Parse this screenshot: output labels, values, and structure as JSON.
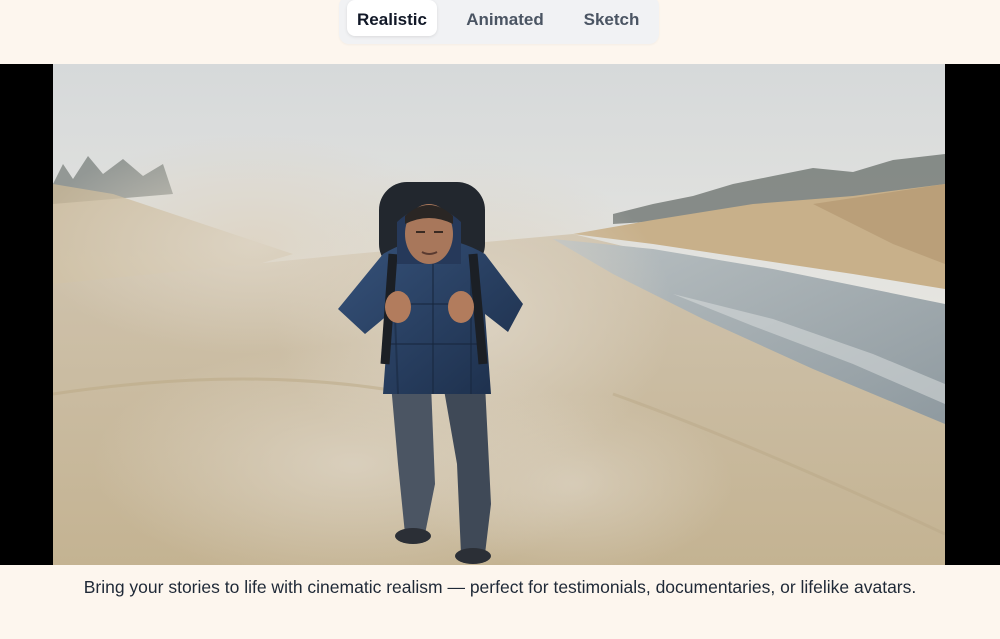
{
  "tabs": {
    "items": [
      {
        "label": "Realistic",
        "active": true
      },
      {
        "label": "Animated",
        "active": false
      },
      {
        "label": "Sketch",
        "active": false
      }
    ]
  },
  "video": {
    "scene": "hiker-in-sandstorm"
  },
  "caption": {
    "text": "Bring your stories to life with cinematic realism — perfect for testimonials, documentaries, or lifelike avatars."
  },
  "colors": {
    "page_background": "#fdf6ee",
    "tab_bar_background": "#f1f2f4",
    "active_tab_background": "#ffffff",
    "letterbox": "#000000"
  }
}
